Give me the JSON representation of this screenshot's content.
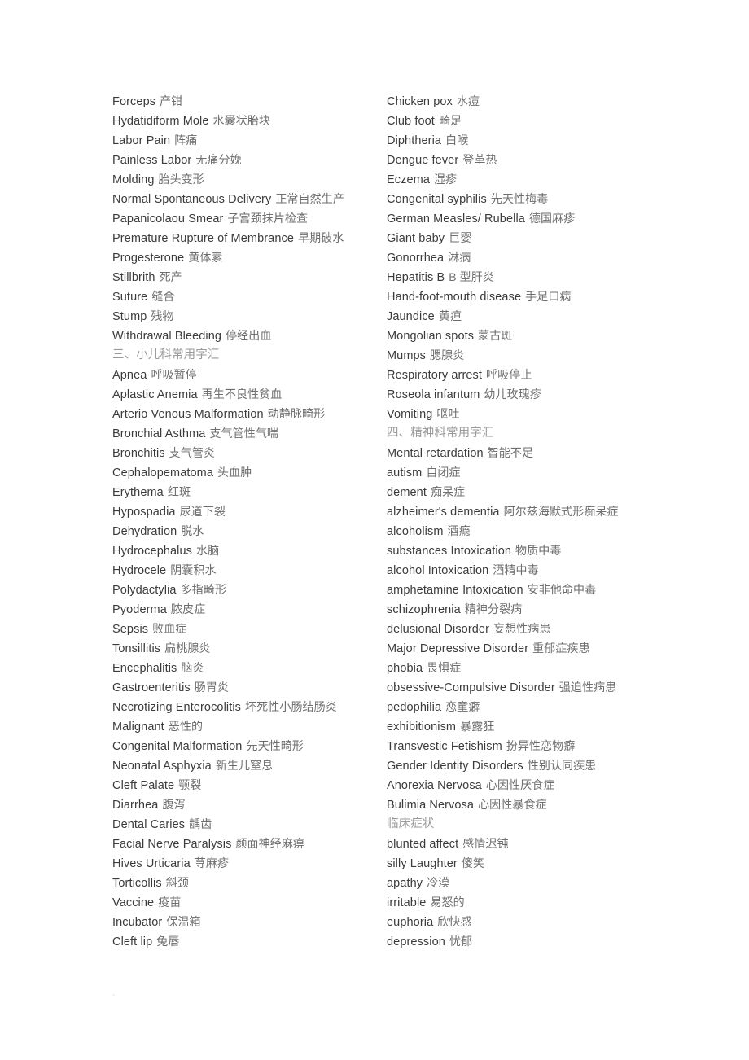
{
  "document": {
    "type": "medical-terminology-glossary",
    "page_background": "#ffffff",
    "text_color_english": "#3b3b3b",
    "text_color_chinese": "#6e6e6e",
    "heading_color": "#9a9a9a"
  },
  "columns": {
    "left": [
      {
        "en": "Forceps",
        "zh": "产钳",
        "heading": false
      },
      {
        "en": "Hydatidiform Mole",
        "zh": "水囊状胎块",
        "heading": false
      },
      {
        "en": "Labor Pain",
        "zh": "阵痛",
        "heading": false
      },
      {
        "en": "Painless Labor",
        "zh": "无痛分娩",
        "heading": false
      },
      {
        "en": "Molding",
        "zh": "胎头变形",
        "heading": false
      },
      {
        "en": "Normal Spontaneous Delivery",
        "zh": "正常自然生产",
        "heading": false
      },
      {
        "en": "Papanicolaou Smear",
        "zh": "子宫颈抹片检查",
        "heading": false
      },
      {
        "en": "Premature Rupture of Membrance",
        "zh": "早期破水",
        "heading": false
      },
      {
        "en": "Progesterone",
        "zh": "黄体素",
        "heading": false
      },
      {
        "en": "Stillbrith",
        "zh": "死产",
        "heading": false
      },
      {
        "en": "Suture",
        "zh": "缝合",
        "heading": false
      },
      {
        "en": "Stump",
        "zh": "残物",
        "heading": false
      },
      {
        "en": "Withdrawal Bleeding",
        "zh": "停经出血",
        "heading": false
      },
      {
        "en": "",
        "zh": "三、小儿科常用字汇",
        "heading": true
      },
      {
        "en": "Apnea",
        "zh": "呼吸暂停",
        "heading": false
      },
      {
        "en": "Aplastic Anemia",
        "zh": "再生不良性贫血",
        "heading": false
      },
      {
        "en": "Arterio Venous Malformation",
        "zh": "动静脉畸形",
        "heading": false
      },
      {
        "en": "Bronchial Asthma",
        "zh": "支气管性气喘",
        "heading": false
      },
      {
        "en": "Bronchitis",
        "zh": "支气管炎",
        "heading": false
      },
      {
        "en": "Cephalopematoma",
        "zh": "头血肿",
        "heading": false
      },
      {
        "en": "Erythema",
        "zh": "红斑",
        "heading": false
      },
      {
        "en": "Hypospadia",
        "zh": "尿道下裂",
        "heading": false
      },
      {
        "en": "Dehydration",
        "zh": "脱水",
        "heading": false
      },
      {
        "en": "Hydrocephalus",
        "zh": "水脑",
        "heading": false
      },
      {
        "en": "Hydrocele",
        "zh": "阴囊积水",
        "heading": false
      },
      {
        "en": "Polydactylia",
        "zh": "多指畸形",
        "heading": false
      },
      {
        "en": "Pyoderma",
        "zh": "脓皮症",
        "heading": false
      },
      {
        "en": "Sepsis",
        "zh": "败血症",
        "heading": false
      },
      {
        "en": "Tonsillitis",
        "zh": "扁桃腺炎",
        "heading": false
      },
      {
        "en": "Encephalitis",
        "zh": "脑炎",
        "heading": false
      },
      {
        "en": "Gastroenteritis",
        "zh": "肠胃炎",
        "heading": false
      },
      {
        "en": "Necrotizing Enterocolitis",
        "zh": "坏死性小肠结肠炎",
        "heading": false
      },
      {
        "en": "Malignant",
        "zh": "恶性的",
        "heading": false
      },
      {
        "en": "Congenital Malformation",
        "zh": "先天性畸形",
        "heading": false
      },
      {
        "en": "Neonatal Asphyxia",
        "zh": "新生儿窒息",
        "heading": false
      },
      {
        "en": "Cleft Palate",
        "zh": "颚裂",
        "heading": false
      },
      {
        "en": "Diarrhea",
        "zh": "腹泻",
        "heading": false
      },
      {
        "en": "Dental Caries",
        "zh": "龋齿",
        "heading": false
      },
      {
        "en": "Facial Nerve Paralysis",
        "zh": "颜面神经麻痹",
        "heading": false
      },
      {
        "en": "Hives Urticaria",
        "zh": "荨麻疹",
        "heading": false
      },
      {
        "en": "Torticollis",
        "zh": "斜颈",
        "heading": false
      },
      {
        "en": "Vaccine",
        "zh": "疫苗",
        "heading": false
      },
      {
        "en": "Incubator",
        "zh": "保温箱",
        "heading": false
      },
      {
        "en": "Cleft lip",
        "zh": "兔唇",
        "heading": false
      }
    ],
    "right": [
      {
        "en": "Chicken pox",
        "zh": "水痘",
        "heading": false
      },
      {
        "en": "Club foot",
        "zh": "畸足",
        "heading": false
      },
      {
        "en": "Diphtheria",
        "zh": "白喉",
        "heading": false
      },
      {
        "en": "Dengue fever",
        "zh": "登革热",
        "heading": false
      },
      {
        "en": "Eczema",
        "zh": "湿疹",
        "heading": false
      },
      {
        "en": "Congenital syphilis",
        "zh": "先天性梅毒",
        "heading": false
      },
      {
        "en": "German Measles/ Rubella",
        "zh": "德国麻疹",
        "heading": false
      },
      {
        "en": "Giant baby",
        "zh": "巨婴",
        "heading": false
      },
      {
        "en": "Gonorrhea",
        "zh": "淋病",
        "heading": false
      },
      {
        "en": "Hepatitis B",
        "zh": "B 型肝炎",
        "heading": false
      },
      {
        "en": "Hand-foot-mouth disease",
        "zh": "手足口病",
        "heading": false
      },
      {
        "en": "Jaundice",
        "zh": "黄疸",
        "heading": false
      },
      {
        "en": "Mongolian spots",
        "zh": "蒙古斑",
        "heading": false
      },
      {
        "en": "Mumps",
        "zh": "腮腺炎",
        "heading": false
      },
      {
        "en": "Respiratory arrest",
        "zh": "呼吸停止",
        "heading": false
      },
      {
        "en": "Roseola infantum",
        "zh": "幼儿玫瑰疹",
        "heading": false
      },
      {
        "en": "Vomiting",
        "zh": "呕吐",
        "heading": false
      },
      {
        "en": "",
        "zh": "四、精神科常用字汇",
        "heading": true
      },
      {
        "en": "Mental retardation",
        "zh": "智能不足",
        "heading": false
      },
      {
        "en": "autism",
        "zh": "自闭症",
        "heading": false
      },
      {
        "en": "dement",
        "zh": "痴呆症",
        "heading": false
      },
      {
        "en": "alzheimer's dementia",
        "zh": "阿尔兹海默式形痴呆症",
        "heading": false
      },
      {
        "en": "alcoholism",
        "zh": "酒瘾",
        "heading": false
      },
      {
        "en": "substances Intoxication",
        "zh": "物质中毒",
        "heading": false
      },
      {
        "en": "alcohol Intoxication",
        "zh": "酒精中毒",
        "heading": false
      },
      {
        "en": "amphetamine Intoxication",
        "zh": "安非他命中毒",
        "heading": false
      },
      {
        "en": "schizophrenia",
        "zh": "精神分裂病",
        "heading": false
      },
      {
        "en": "delusional Disorder",
        "zh": "妄想性病患",
        "heading": false
      },
      {
        "en": "Major Depressive Disorder",
        "zh": "重郁症疾患",
        "heading": false
      },
      {
        "en": "phobia",
        "zh": "畏惧症",
        "heading": false
      },
      {
        "en": "obsessive-Compulsive Disorder",
        "zh": "强迫性病患",
        "heading": false
      },
      {
        "en": "pedophilia",
        "zh": "恋童癖",
        "heading": false
      },
      {
        "en": "exhibitionism",
        "zh": "暴露狂",
        "heading": false
      },
      {
        "en": "Transvestic Fetishism",
        "zh": "扮异性恋物癖",
        "heading": false
      },
      {
        "en": "Gender Identity Disorders",
        "zh": "性别认同疾患",
        "heading": false
      },
      {
        "en": "Anorexia Nervosa",
        "zh": "心因性厌食症",
        "heading": false
      },
      {
        "en": "Bulimia Nervosa",
        "zh": "心因性暴食症",
        "heading": false
      },
      {
        "en": "",
        "zh": "临床症状",
        "heading": true
      },
      {
        "en": "blunted affect",
        "zh": "感情迟钝",
        "heading": false
      },
      {
        "en": "silly Laughter",
        "zh": "傻笑",
        "heading": false
      },
      {
        "en": "apathy",
        "zh": "冷漠",
        "heading": false
      },
      {
        "en": "irritable",
        "zh": "易怒的",
        "heading": false
      },
      {
        "en": "euphoria",
        "zh": "欣快感",
        "heading": false
      },
      {
        "en": "depression",
        "zh": "忧郁",
        "heading": false
      }
    ]
  }
}
